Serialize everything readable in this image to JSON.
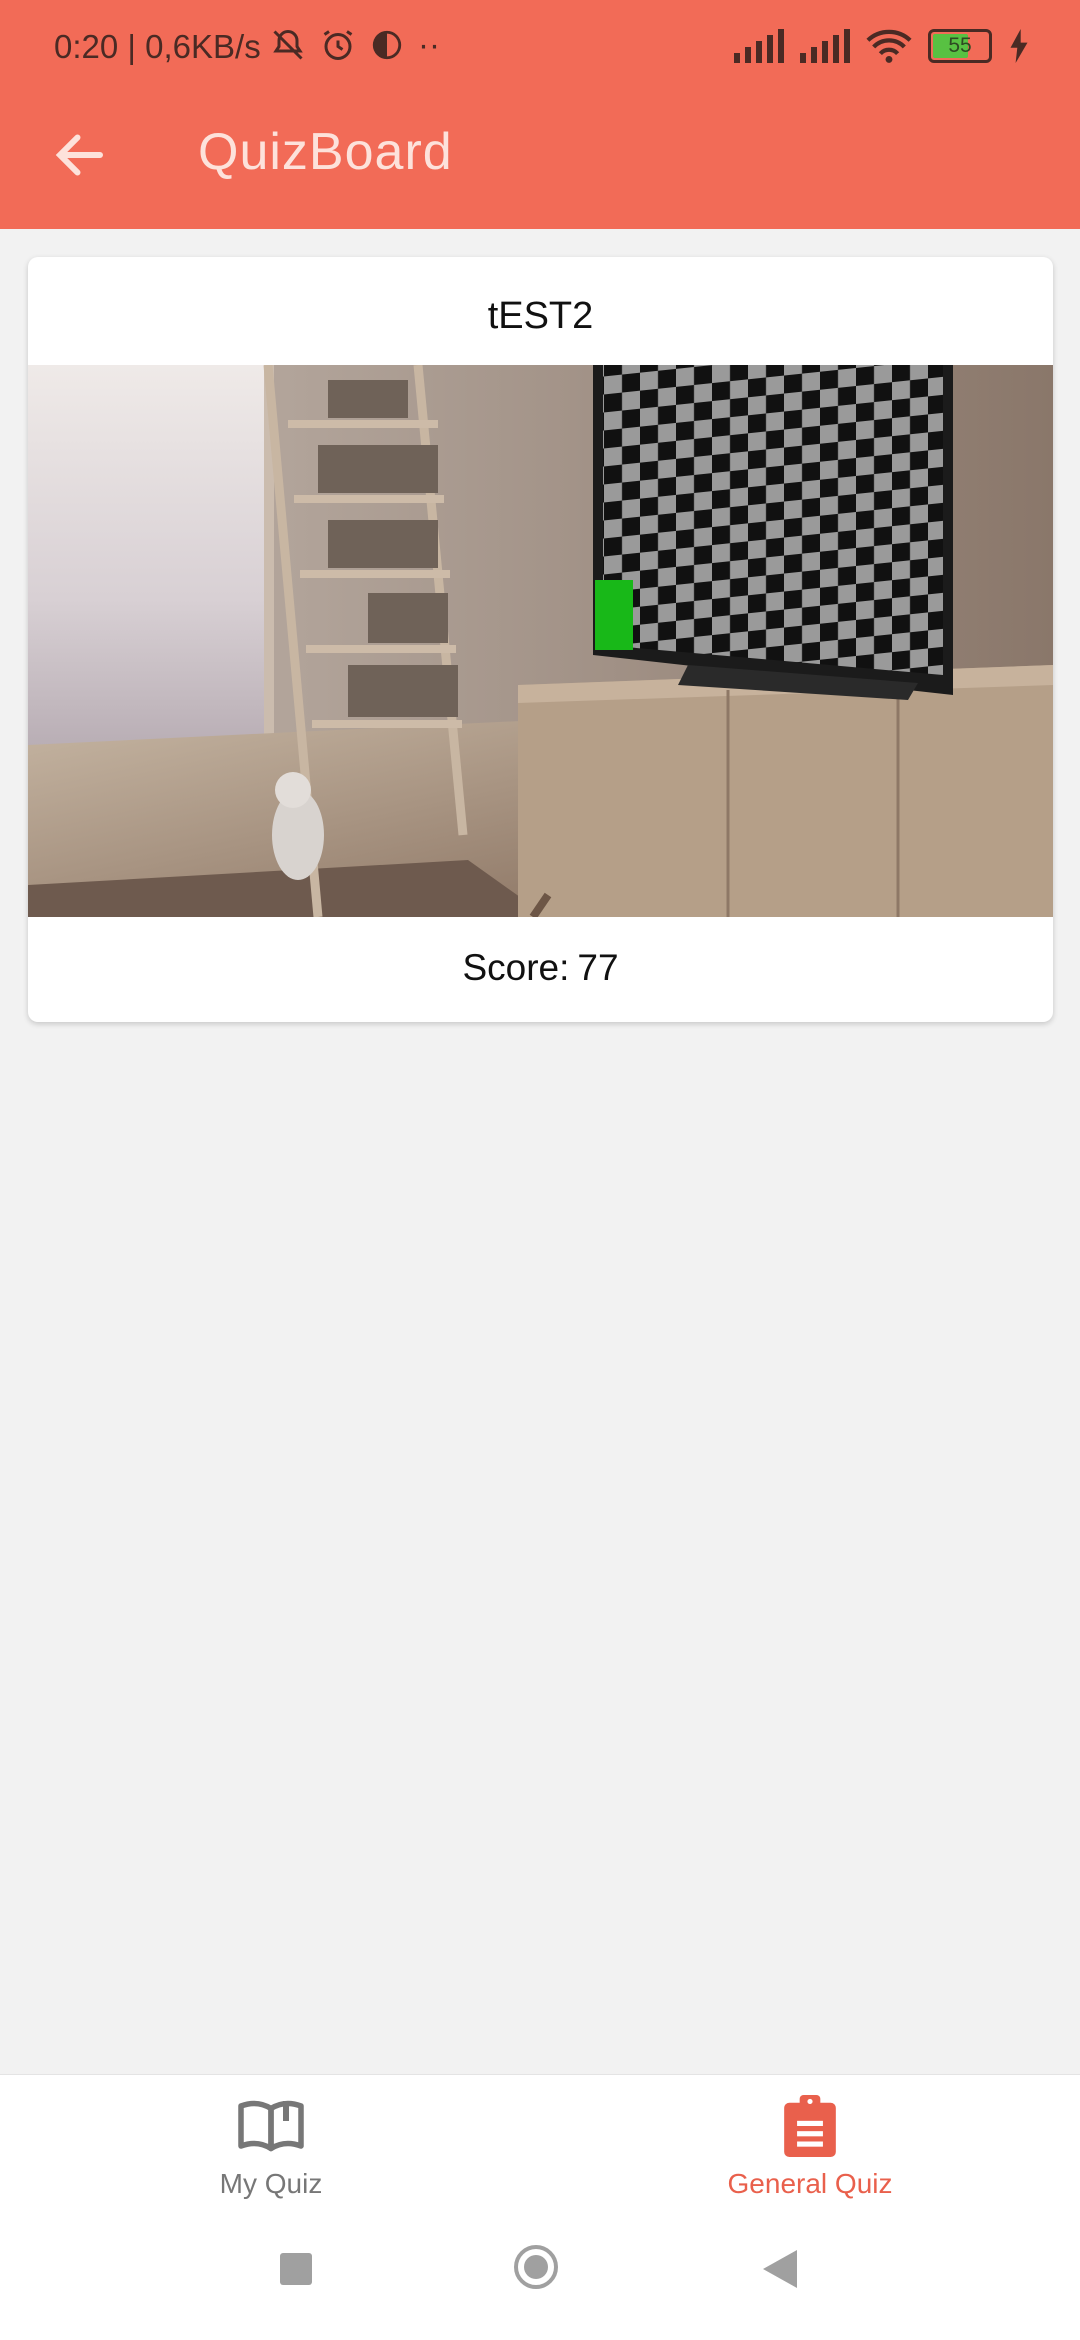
{
  "status_bar": {
    "time_speed": "0:20 | 0,6KB/s",
    "dots": "··",
    "battery_level": "55",
    "icons": [
      "mute-bell-icon",
      "alarm-icon",
      "app-icon",
      "signal-icon",
      "signal-icon",
      "wifi-icon",
      "battery-icon",
      "charging-icon"
    ]
  },
  "header": {
    "title": "QuizBoard",
    "back_icon": "arrow-left-icon"
  },
  "quiz_card": {
    "title": "tEST2",
    "score_label": "Score:",
    "score_value": "77"
  },
  "bottom_nav": {
    "items": [
      {
        "label": "My Quiz",
        "icon": "open-book-icon",
        "active": false
      },
      {
        "label": "General Quiz",
        "icon": "clipboard-icon",
        "active": true
      }
    ]
  },
  "colors": {
    "accent": "#f26b57",
    "active_tab": "#e9604c",
    "inactive_tab": "#777777"
  }
}
